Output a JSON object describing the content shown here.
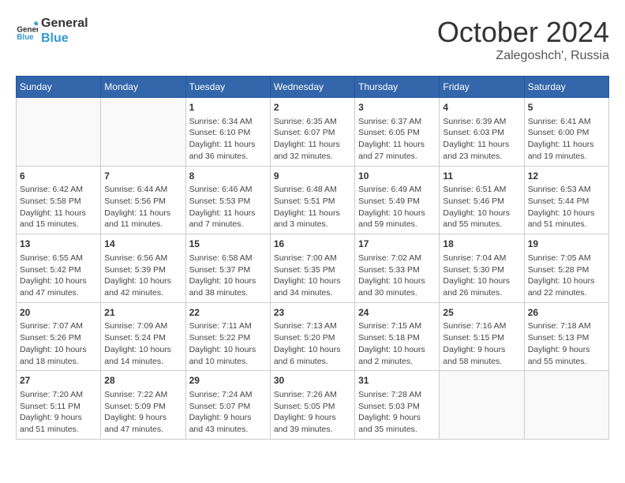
{
  "header": {
    "logo_line1": "General",
    "logo_line2": "Blue",
    "month": "October 2024",
    "location": "Zalegoshch', Russia"
  },
  "days_of_week": [
    "Sunday",
    "Monday",
    "Tuesday",
    "Wednesday",
    "Thursday",
    "Friday",
    "Saturday"
  ],
  "weeks": [
    [
      {
        "day": "",
        "sunrise": "",
        "sunset": "",
        "daylight": "",
        "empty": true
      },
      {
        "day": "",
        "sunrise": "",
        "sunset": "",
        "daylight": "",
        "empty": true
      },
      {
        "day": "1",
        "sunrise": "Sunrise: 6:34 AM",
        "sunset": "Sunset: 6:10 PM",
        "daylight": "Daylight: 11 hours and 36 minutes."
      },
      {
        "day": "2",
        "sunrise": "Sunrise: 6:35 AM",
        "sunset": "Sunset: 6:07 PM",
        "daylight": "Daylight: 11 hours and 32 minutes."
      },
      {
        "day": "3",
        "sunrise": "Sunrise: 6:37 AM",
        "sunset": "Sunset: 6:05 PM",
        "daylight": "Daylight: 11 hours and 27 minutes."
      },
      {
        "day": "4",
        "sunrise": "Sunrise: 6:39 AM",
        "sunset": "Sunset: 6:03 PM",
        "daylight": "Daylight: 11 hours and 23 minutes."
      },
      {
        "day": "5",
        "sunrise": "Sunrise: 6:41 AM",
        "sunset": "Sunset: 6:00 PM",
        "daylight": "Daylight: 11 hours and 19 minutes."
      }
    ],
    [
      {
        "day": "6",
        "sunrise": "Sunrise: 6:42 AM",
        "sunset": "Sunset: 5:58 PM",
        "daylight": "Daylight: 11 hours and 15 minutes."
      },
      {
        "day": "7",
        "sunrise": "Sunrise: 6:44 AM",
        "sunset": "Sunset: 5:56 PM",
        "daylight": "Daylight: 11 hours and 11 minutes."
      },
      {
        "day": "8",
        "sunrise": "Sunrise: 6:46 AM",
        "sunset": "Sunset: 5:53 PM",
        "daylight": "Daylight: 11 hours and 7 minutes."
      },
      {
        "day": "9",
        "sunrise": "Sunrise: 6:48 AM",
        "sunset": "Sunset: 5:51 PM",
        "daylight": "Daylight: 11 hours and 3 minutes."
      },
      {
        "day": "10",
        "sunrise": "Sunrise: 6:49 AM",
        "sunset": "Sunset: 5:49 PM",
        "daylight": "Daylight: 10 hours and 59 minutes."
      },
      {
        "day": "11",
        "sunrise": "Sunrise: 6:51 AM",
        "sunset": "Sunset: 5:46 PM",
        "daylight": "Daylight: 10 hours and 55 minutes."
      },
      {
        "day": "12",
        "sunrise": "Sunrise: 6:53 AM",
        "sunset": "Sunset: 5:44 PM",
        "daylight": "Daylight: 10 hours and 51 minutes."
      }
    ],
    [
      {
        "day": "13",
        "sunrise": "Sunrise: 6:55 AM",
        "sunset": "Sunset: 5:42 PM",
        "daylight": "Daylight: 10 hours and 47 minutes."
      },
      {
        "day": "14",
        "sunrise": "Sunrise: 6:56 AM",
        "sunset": "Sunset: 5:39 PM",
        "daylight": "Daylight: 10 hours and 42 minutes."
      },
      {
        "day": "15",
        "sunrise": "Sunrise: 6:58 AM",
        "sunset": "Sunset: 5:37 PM",
        "daylight": "Daylight: 10 hours and 38 minutes."
      },
      {
        "day": "16",
        "sunrise": "Sunrise: 7:00 AM",
        "sunset": "Sunset: 5:35 PM",
        "daylight": "Daylight: 10 hours and 34 minutes."
      },
      {
        "day": "17",
        "sunrise": "Sunrise: 7:02 AM",
        "sunset": "Sunset: 5:33 PM",
        "daylight": "Daylight: 10 hours and 30 minutes."
      },
      {
        "day": "18",
        "sunrise": "Sunrise: 7:04 AM",
        "sunset": "Sunset: 5:30 PM",
        "daylight": "Daylight: 10 hours and 26 minutes."
      },
      {
        "day": "19",
        "sunrise": "Sunrise: 7:05 AM",
        "sunset": "Sunset: 5:28 PM",
        "daylight": "Daylight: 10 hours and 22 minutes."
      }
    ],
    [
      {
        "day": "20",
        "sunrise": "Sunrise: 7:07 AM",
        "sunset": "Sunset: 5:26 PM",
        "daylight": "Daylight: 10 hours and 18 minutes."
      },
      {
        "day": "21",
        "sunrise": "Sunrise: 7:09 AM",
        "sunset": "Sunset: 5:24 PM",
        "daylight": "Daylight: 10 hours and 14 minutes."
      },
      {
        "day": "22",
        "sunrise": "Sunrise: 7:11 AM",
        "sunset": "Sunset: 5:22 PM",
        "daylight": "Daylight: 10 hours and 10 minutes."
      },
      {
        "day": "23",
        "sunrise": "Sunrise: 7:13 AM",
        "sunset": "Sunset: 5:20 PM",
        "daylight": "Daylight: 10 hours and 6 minutes."
      },
      {
        "day": "24",
        "sunrise": "Sunrise: 7:15 AM",
        "sunset": "Sunset: 5:18 PM",
        "daylight": "Daylight: 10 hours and 2 minutes."
      },
      {
        "day": "25",
        "sunrise": "Sunrise: 7:16 AM",
        "sunset": "Sunset: 5:15 PM",
        "daylight": "Daylight: 9 hours and 58 minutes."
      },
      {
        "day": "26",
        "sunrise": "Sunrise: 7:18 AM",
        "sunset": "Sunset: 5:13 PM",
        "daylight": "Daylight: 9 hours and 55 minutes."
      }
    ],
    [
      {
        "day": "27",
        "sunrise": "Sunrise: 7:20 AM",
        "sunset": "Sunset: 5:11 PM",
        "daylight": "Daylight: 9 hours and 51 minutes."
      },
      {
        "day": "28",
        "sunrise": "Sunrise: 7:22 AM",
        "sunset": "Sunset: 5:09 PM",
        "daylight": "Daylight: 9 hours and 47 minutes."
      },
      {
        "day": "29",
        "sunrise": "Sunrise: 7:24 AM",
        "sunset": "Sunset: 5:07 PM",
        "daylight": "Daylight: 9 hours and 43 minutes."
      },
      {
        "day": "30",
        "sunrise": "Sunrise: 7:26 AM",
        "sunset": "Sunset: 5:05 PM",
        "daylight": "Daylight: 9 hours and 39 minutes."
      },
      {
        "day": "31",
        "sunrise": "Sunrise: 7:28 AM",
        "sunset": "Sunset: 5:03 PM",
        "daylight": "Daylight: 9 hours and 35 minutes."
      },
      {
        "day": "",
        "sunrise": "",
        "sunset": "",
        "daylight": "",
        "empty": true
      },
      {
        "day": "",
        "sunrise": "",
        "sunset": "",
        "daylight": "",
        "empty": true
      }
    ]
  ]
}
